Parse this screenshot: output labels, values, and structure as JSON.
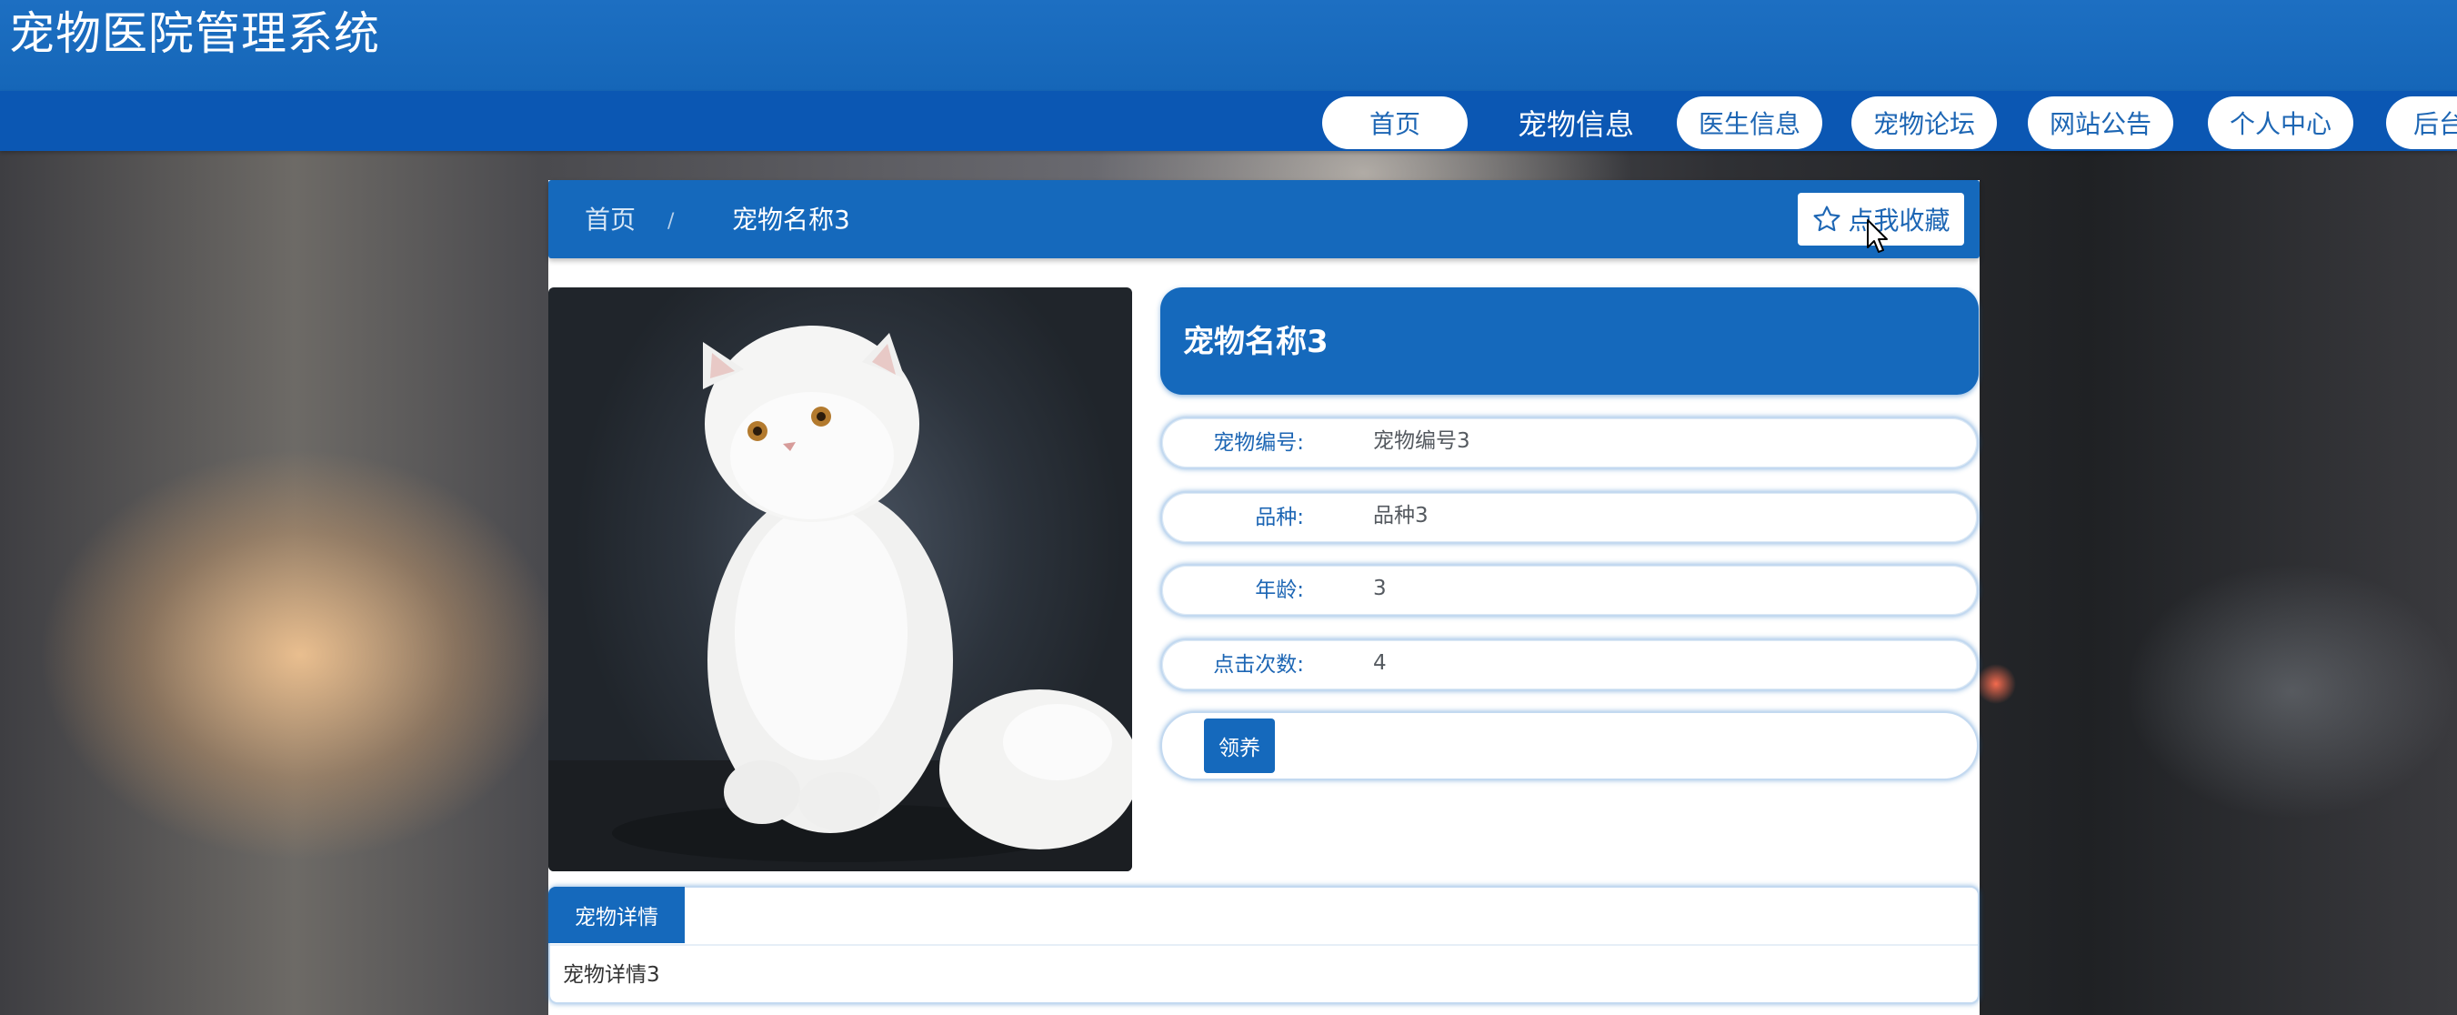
{
  "site": {
    "title": "宠物医院管理系统"
  },
  "nav": {
    "items": [
      {
        "label": "首页",
        "active": false
      },
      {
        "label": "宠物信息",
        "active": true
      },
      {
        "label": "医生信息",
        "active": false
      },
      {
        "label": "宠物论坛",
        "active": false
      },
      {
        "label": "网站公告",
        "active": false
      },
      {
        "label": "个人中心",
        "active": false
      },
      {
        "label": "后台管理",
        "active": false
      }
    ]
  },
  "breadcrumb": {
    "home": "首页",
    "separator": "/",
    "current": "宠物名称3"
  },
  "favorite": {
    "label": "点我收藏",
    "icon": "star-outline-icon"
  },
  "pet": {
    "name": "宠物名称3",
    "fields": [
      {
        "label": "宠物编号:",
        "value": "宠物编号3"
      },
      {
        "label": "品种:",
        "value": "品种3"
      },
      {
        "label": "年龄:",
        "value": "3"
      },
      {
        "label": "点击次数:",
        "value": "4"
      }
    ],
    "adopt_label": "领养",
    "photo": "white persian cat photo"
  },
  "detail": {
    "tab_label": "宠物详情",
    "content": "宠物详情3"
  },
  "colors": {
    "primary": "#1569bc",
    "nav_bg": "#0b57b3",
    "header_bg": "#1d6fc2",
    "text_link": "#1d66b4"
  }
}
